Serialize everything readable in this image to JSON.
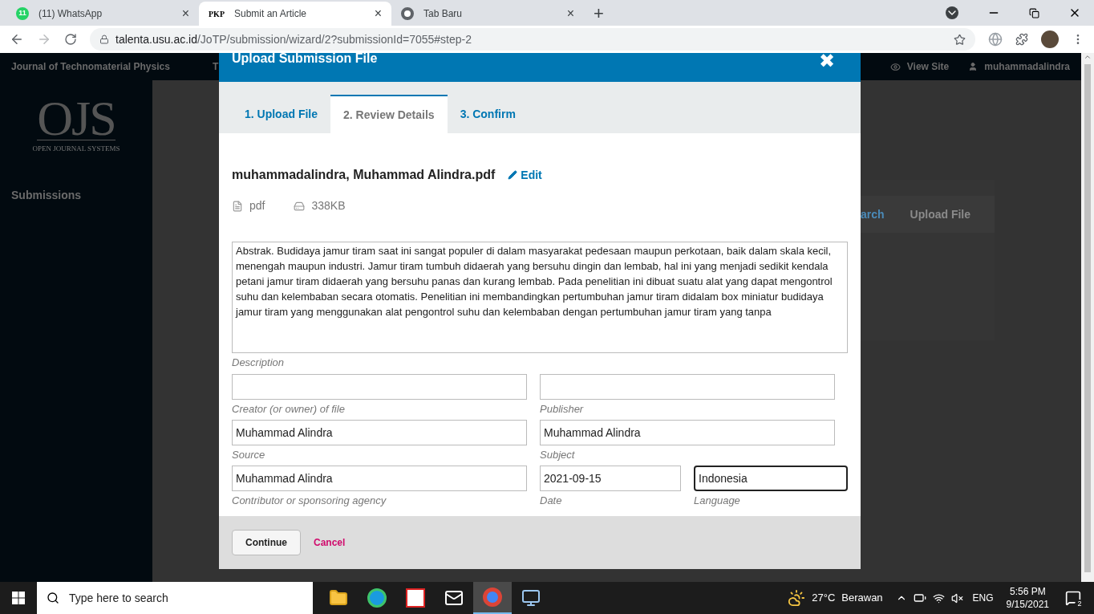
{
  "browser": {
    "tabs": [
      {
        "kind": "whatsapp",
        "badge": "11",
        "title": "(11) WhatsApp",
        "close": "×",
        "selected": false
      },
      {
        "kind": "pkp",
        "badge": "PKP",
        "title": "Submit an Article",
        "close": "×",
        "selected": true
      },
      {
        "kind": "chrome",
        "title": "Tab Baru",
        "close": "×",
        "selected": false
      }
    ],
    "new_tab": "+",
    "forward_disabled": true,
    "url_host": "talenta.usu.ac.id",
    "url_path": "/JoTP/submission/wizard/2?submissionId=7055#step-2"
  },
  "site": {
    "journal": "Journal of Technomaterial Physics",
    "nav_cut": "T",
    "view_site": "View Site",
    "user": "muhammadalindra",
    "logo": "OJS",
    "logo_caption": "OPEN JOURNAL SYSTEMS",
    "sidebar": [
      {
        "label": "Submissions"
      }
    ],
    "panel_tabs": [
      {
        "label": "arch",
        "selected": true
      },
      {
        "label": "Upload File",
        "selected": false
      }
    ]
  },
  "modal": {
    "title": "Upload Submission File",
    "close": "✖",
    "steps": [
      {
        "label": "1. Upload File",
        "selected": false
      },
      {
        "label": "2. Review Details",
        "selected": true
      },
      {
        "label": "3. Confirm",
        "selected": false
      }
    ],
    "file_name": "muhammadalindra, Muhammad Alindra.pdf",
    "edit": "Edit",
    "file_type": "pdf",
    "file_size": "338KB",
    "description": {
      "value": "Abstrak. Budidaya jamur tiram saat ini sangat populer di dalam masyarakat pedesaan maupun perkotaan, baik dalam skala kecil, menengah maupun industri. Jamur tiram tumbuh didaerah yang bersuhu dingin dan lembab, hal ini yang menjadi sedikit kendala petani jamur tiram didaerah yang bersuhu panas dan kurang lembab. Pada penelitian ini dibuat suatu alat yang dapat mengontrol suhu dan kelembaban secara otomatis. Penelitian ini membandingkan pertumbuhan jamur tiram didalam box miniatur budidaya jamur tiram yang menggunakan alat pengontrol suhu dan kelembaban dengan pertumbuhan jamur tiram yang tanpa",
      "label": "Description"
    },
    "field_rows": [
      [
        {
          "label": "Creator (or owner) of file",
          "focused": false
        },
        {
          "label": "Publisher",
          "focused": false
        }
      ],
      [
        {
          "value": "Muhammad Alindra",
          "label": "Source",
          "focused": false
        },
        {
          "value": "Muhammad Alindra",
          "label": "Subject",
          "focused": false
        }
      ],
      [
        {
          "value": "Muhammad Alindra",
          "label": "Contributor or sponsoring agency",
          "focused": false
        },
        {
          "value": "2021-09-15",
          "label": "Date",
          "focused": false
        },
        {
          "value": "Indonesia",
          "label": "Language",
          "focused": true
        }
      ]
    ],
    "continue": "Continue",
    "cancel": "Cancel"
  },
  "taskbar": {
    "search_placeholder": "Type here to search",
    "apps": [
      {
        "kind": "folder",
        "selected": false
      },
      {
        "kind": "edge",
        "selected": false
      },
      {
        "kind": "cs",
        "selected": false
      },
      {
        "kind": "mail",
        "selected": false
      },
      {
        "kind": "chrome",
        "selected": true
      },
      {
        "kind": "network",
        "selected": false
      }
    ],
    "weather": "27°C",
    "weather_text": "Berawan",
    "language": "ENG",
    "time": "5:56 PM",
    "date": "9/15/2021",
    "notifications": "2"
  }
}
